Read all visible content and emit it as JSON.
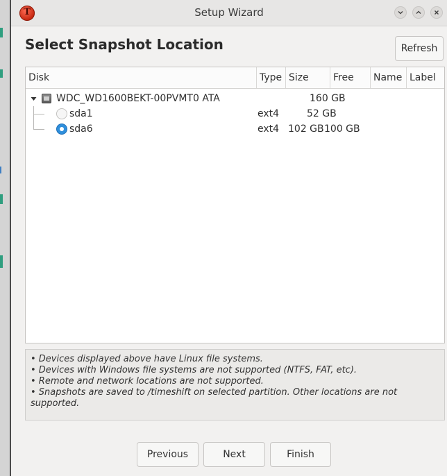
{
  "window": {
    "title": "Setup Wizard",
    "app_icon_letter": "T"
  },
  "page": {
    "heading": "Select Snapshot Location",
    "refresh_label": "Refresh"
  },
  "table": {
    "columns": [
      "Disk",
      "Type",
      "Size",
      "Free",
      "Name",
      "Label"
    ],
    "disk": {
      "name": "WDC_WD1600BEKT-00PVMT0 ATA",
      "size": "160 GB"
    },
    "partitions": [
      {
        "name": "sda1",
        "type": "ext4",
        "size": "52 GB",
        "free": "",
        "selected": false
      },
      {
        "name": "sda6",
        "type": "ext4",
        "size": "102 GB",
        "free": "100 GB",
        "selected": true
      }
    ]
  },
  "notes": [
    "• Devices displayed above have Linux file systems.",
    "• Devices with Windows file systems are not supported (NTFS, FAT, etc).",
    "• Remote and network locations are not supported.",
    "• Snapshots are saved to /timeshift on selected partition. Other locations are not supported."
  ],
  "buttons": {
    "previous": "Previous",
    "next": "Next",
    "finish": "Finish"
  },
  "colors": {
    "accent": "#2f8fdc",
    "app_icon": "#c4250e"
  }
}
